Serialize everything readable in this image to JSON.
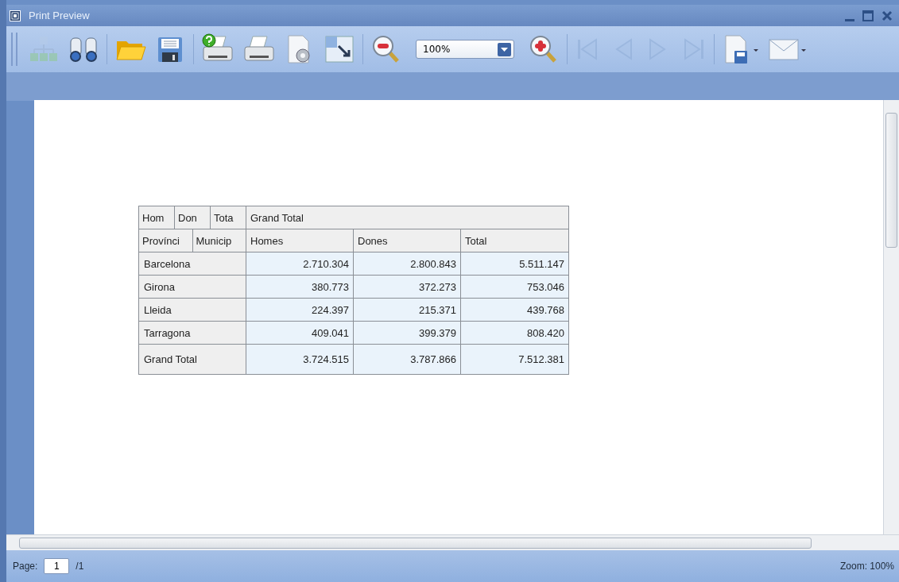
{
  "window": {
    "title": "Print Preview"
  },
  "toolbar": [
    {
      "kind": "tree",
      "disabled": true
    },
    {
      "kind": "find",
      "disabled": false
    },
    {
      "kind": "separator"
    },
    {
      "kind": "open",
      "disabled": false
    },
    {
      "kind": "save",
      "disabled": false
    },
    {
      "kind": "separator"
    },
    {
      "kind": "print-dialog",
      "disabled": false
    },
    {
      "kind": "print",
      "disabled": false
    },
    {
      "kind": "page-setup",
      "disabled": false
    },
    {
      "kind": "scale",
      "disabled": false
    },
    {
      "kind": "separator"
    },
    {
      "kind": "zoom-out",
      "disabled": false
    },
    {
      "kind": "zoom-combo",
      "value": "100%"
    },
    {
      "kind": "zoom-in",
      "disabled": false
    },
    {
      "kind": "separator"
    },
    {
      "kind": "first",
      "disabled": true
    },
    {
      "kind": "prev",
      "disabled": true
    },
    {
      "kind": "next",
      "disabled": true
    },
    {
      "kind": "last",
      "disabled": true
    },
    {
      "kind": "separator"
    },
    {
      "kind": "export",
      "disabled": false
    },
    {
      "kind": "email",
      "disabled": false
    }
  ],
  "table": {
    "data_fields": [
      "Hom",
      "Don",
      "Tota"
    ],
    "column_header": "Grand Total",
    "row_fields": [
      "Provínci",
      "Municip"
    ],
    "columns": [
      "Homes",
      "Dones",
      "Total"
    ],
    "rows": [
      {
        "label": "Barcelona",
        "values": [
          "2.710.304",
          "2.800.843",
          "5.511.147"
        ]
      },
      {
        "label": "Girona",
        "values": [
          "380.773",
          "372.273",
          "753.046"
        ]
      },
      {
        "label": "Lleida",
        "values": [
          "224.397",
          "215.371",
          "439.768"
        ]
      },
      {
        "label": "Tarragona",
        "values": [
          "409.041",
          "399.379",
          "808.420"
        ]
      }
    ],
    "total": {
      "label": "Grand Total",
      "values": [
        "3.724.515",
        "3.787.866",
        "7.512.381"
      ]
    }
  },
  "status_bar": {
    "page_label": "Page:",
    "page": "1",
    "page_count": "/1",
    "zoom": "Zoom: 100%"
  }
}
